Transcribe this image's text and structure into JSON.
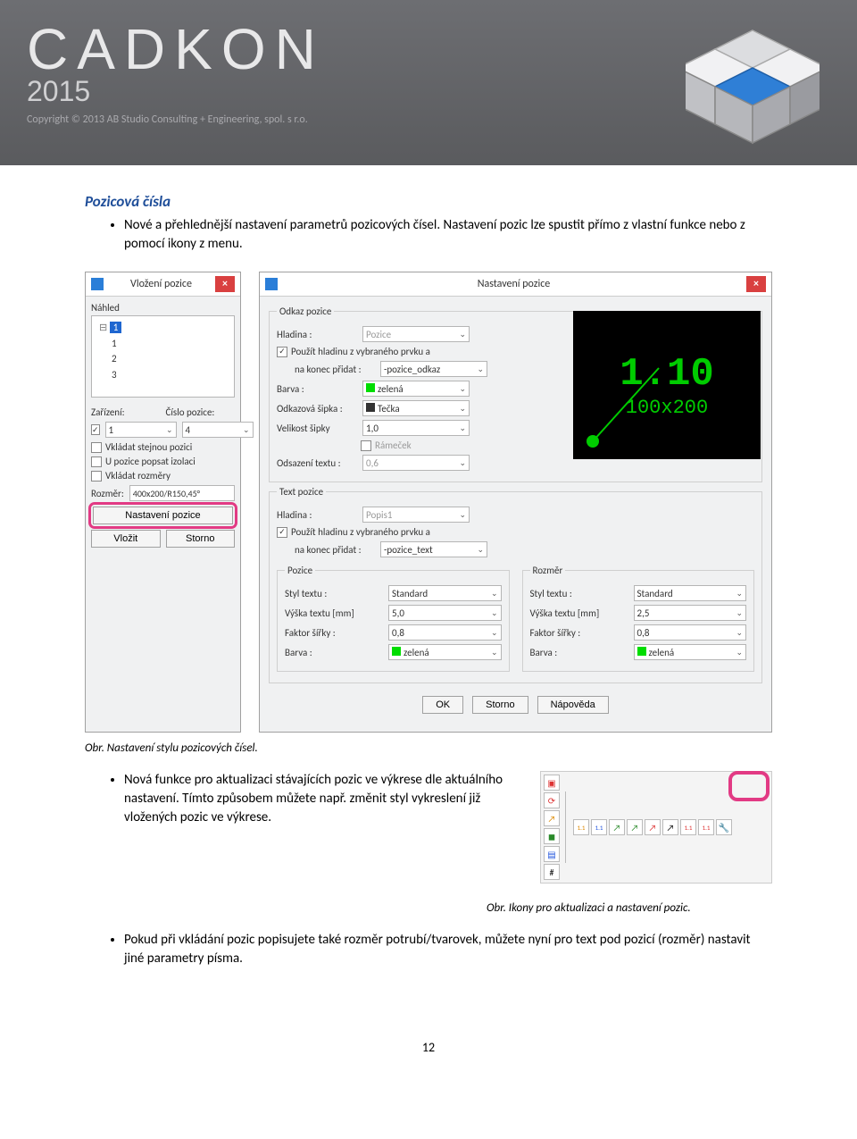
{
  "header": {
    "brand": "CADKON",
    "year": "2015",
    "copyright": "Copyright © 2013 AB Studio Consulting + Engineering, spol. s r.o."
  },
  "section_title": "Pozicová čísla",
  "bullet1": "Nové a přehlednější nastavení parametrů pozicových čísel. Nastavení pozic lze spustit přímo z vlastní funkce nebo z pomocí ikony z menu.",
  "caption1": "Obr. Nastavení stylu pozicových čísel.",
  "bullet2": "Nová funkce pro aktualizaci stávajících pozic ve výkrese dle aktuálního nastavení. Tímto způsobem můžete např. změnit styl vykreslení již vložených pozic ve výkrese.",
  "caption2": "Obr. Ikony pro aktualizaci a nastavení pozic.",
  "bullet3": "Pokud při vkládání pozic popisujete také rozměr potrubí/tvarovek, můžete nyní pro text pod pozicí (rozměr) nastavit jiné parametry písma.",
  "page_number": "12",
  "dlg_left": {
    "title": "Vložení pozice",
    "nahled": "Náhled",
    "tree_root": "1",
    "tree_items": [
      "1",
      "2",
      "3"
    ],
    "zarizeni": "Zařízení:",
    "cislo": "Číslo pozice:",
    "zarizeni_val": "1",
    "cislo_val": "4",
    "chk1": "Vkládat stejnou pozici",
    "chk2": "U pozice popsat izolaci",
    "chk3": "Vkládat rozměry",
    "rozmer": "Rozměr:",
    "rozmer_val": "400x200/R150,45°",
    "btn_nastaveni": "Nastavení pozice",
    "btn_vlozit": "Vložit",
    "btn_storno": "Storno"
  },
  "dlg_right": {
    "title": "Nastavení pozice",
    "grp_odkaz": "Odkaz pozice",
    "hladina": "Hladina :",
    "hladina_val": "Pozice",
    "chk_pouzit": "Použít hladinu z vybraného prvku a",
    "nakonec": "na konec přidat :",
    "nakonec_val": "-pozice_odkaz",
    "barva": "Barva :",
    "barva_val": "zelená",
    "sipka": "Odkazová šipka :",
    "sipka_val": "Tečka",
    "velikost": "Velikost šipky",
    "velikost_val": "1,0",
    "ramecek": "Rámeček",
    "odsazeni": "Odsazení textu :",
    "odsazeni_val": "0,6",
    "grp_text": "Text pozice",
    "hladina2_val": "Popis1",
    "nakonec2_val": "-pozice_text",
    "grp_pozice": "Pozice",
    "grp_rozmer": "Rozměr",
    "styl": "Styl textu :",
    "styl_val": "Standard",
    "vyska": "Výška textu [mm]",
    "vyska_val": "5,0",
    "vyska_val_r": "2,5",
    "faktor": "Faktor šířky :",
    "faktor_val": "0,8",
    "preview_main": "1.10",
    "preview_sub": "100x200",
    "btn_ok": "OK",
    "btn_storno": "Storno",
    "btn_napoveda": "Nápověda"
  }
}
